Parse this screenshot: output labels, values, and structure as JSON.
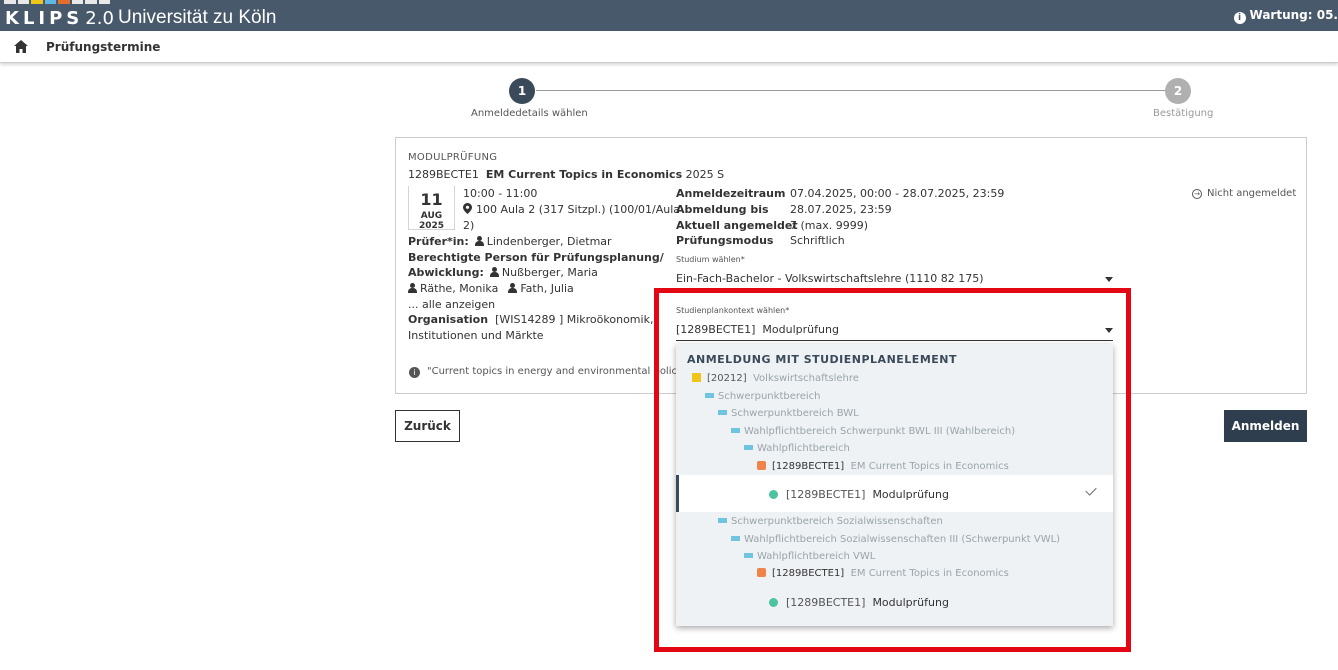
{
  "header": {
    "logo_text": "KLIPS",
    "logo_version": "2.0",
    "logo_colors": [
      "#e8e8e8",
      "#e8e8e8",
      "#f0c419",
      "#5fb7e4",
      "#e46c2c",
      "#e8e8e8",
      "#e8e8e8",
      "#e8e8e8"
    ],
    "university": "Universität zu Köln",
    "maintenance": "Wartung: 05."
  },
  "nav": {
    "breadcrumb": "Prüfungstermine"
  },
  "stepper": {
    "step1_number": "1",
    "step1_label": "Anmeldedetails wählen",
    "step2_number": "2",
    "step2_label": "Bestätigung"
  },
  "exam": {
    "type": "MODULPRÜFUNG",
    "code": "1289BECTE1",
    "title": "EM Current Topics in Economics",
    "semester": "2025 S",
    "date_day": "11",
    "date_month": "AUG 2025",
    "time": "10:00 - 11:00",
    "room_line1": "100 Aula 2 (317 Sitzpl.) (100/01/Aula",
    "room_line2": "2)",
    "examiner_label": "Prüfer*in:",
    "examiner": "Lindenberger, Dietmar",
    "responsible_label_1": "Berechtigte Person für Prüfungsplanung/",
    "responsible_label_2": "Abwicklung:",
    "responsible_1": "Nußberger, Maria",
    "responsible_2": "Räthe, Monika",
    "responsible_3": "Fath, Julia",
    "show_all": "... alle anzeigen",
    "org_label": "Organisation",
    "org_line1": "[WIS14289 ] Mikroökonomik,",
    "org_line2": "Institutionen und Märkte",
    "note": "\"Current topics in energy and environmental policy\" [Lin",
    "status": "Nicht angemeldet"
  },
  "details": {
    "reg_period_label": "Anmeldezeitraum",
    "reg_period": "07.04.2025, 00:00 - 28.07.2025, 23:59",
    "dereg_label": "Abmeldung bis",
    "dereg": "28.07.2025, 23:59",
    "current_label": "Aktuell angemeldet",
    "current": "7 (max. 9999)",
    "mode_label": "Prüfungsmodus",
    "mode": "Schriftlich",
    "study_select_label": "Studium wählen*",
    "study_select_value": "Ein-Fach-Bachelor - Volkswirtschaftslehre (1110 82 175)",
    "context_select_label": "Studienplankontext wählen*",
    "context_select_value": "[1289BECTE1]  Modulprüfung"
  },
  "dropdown": {
    "heading": "ANMELDUNG MIT STUDIENPLANELEMENT",
    "items": [
      {
        "code": "[20212]",
        "label": "Volkswirtschaftslehre"
      },
      {
        "label": "Schwerpunktbereich"
      },
      {
        "label": "Schwerpunktbereich BWL"
      },
      {
        "label": "Wahlpflichtbereich Schwerpunkt BWL III (Wahlbereich)"
      },
      {
        "label": "Wahlpflichtbereich"
      },
      {
        "code": "[1289BECTE1]",
        "label": "EM Current Topics in Economics"
      },
      {
        "code": "[1289BECTE1]",
        "label": "Modulprüfung"
      },
      {
        "label": "Schwerpunktbereich Sozialwissenschaften"
      },
      {
        "label": "Wahlpflichtbereich Sozialwissenschaften III (Schwerpunkt VWL)"
      },
      {
        "label": "Wahlpflichtbereich VWL"
      },
      {
        "code": "[1289BECTE1]",
        "label": "EM Current Topics in Economics"
      },
      {
        "code": "[1289BECTE1]",
        "label": "Modulprüfung"
      }
    ]
  },
  "buttons": {
    "back": "Zurück",
    "submit": "Anmelden"
  }
}
